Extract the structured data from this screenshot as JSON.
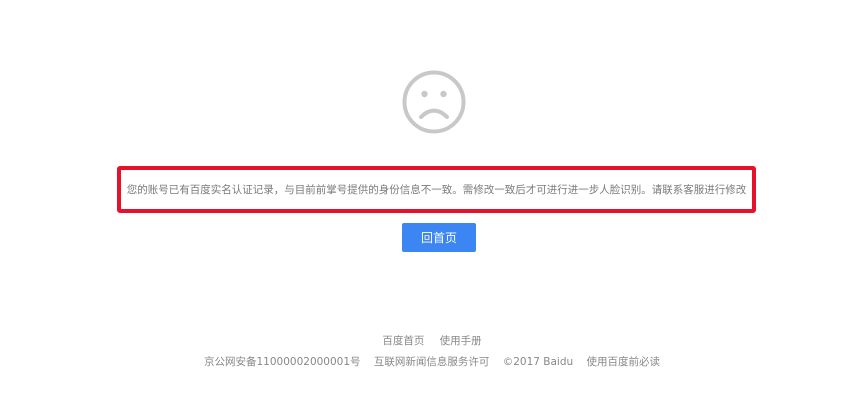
{
  "icon": {
    "name": "sad-face-icon",
    "color": "#c8c8c8"
  },
  "message": {
    "text": "您的账号已有百度实名认证记录，与目前前掌号提供的身份信息不一致。需修改一致后才可进行进一步人脸识别。请联系客服进行修改",
    "border_color": "#e8112b",
    "text_color": "#7a7a7a"
  },
  "button": {
    "label": "回首页",
    "color": "#3b86f3"
  },
  "footer": {
    "links": [
      "百度首页",
      "使用手册"
    ],
    "icp": "京公网安备11000002000001号",
    "license": "互联网新闻信息服务许可",
    "copyright": "©2017 Baidu",
    "terms": "使用百度前必读"
  }
}
